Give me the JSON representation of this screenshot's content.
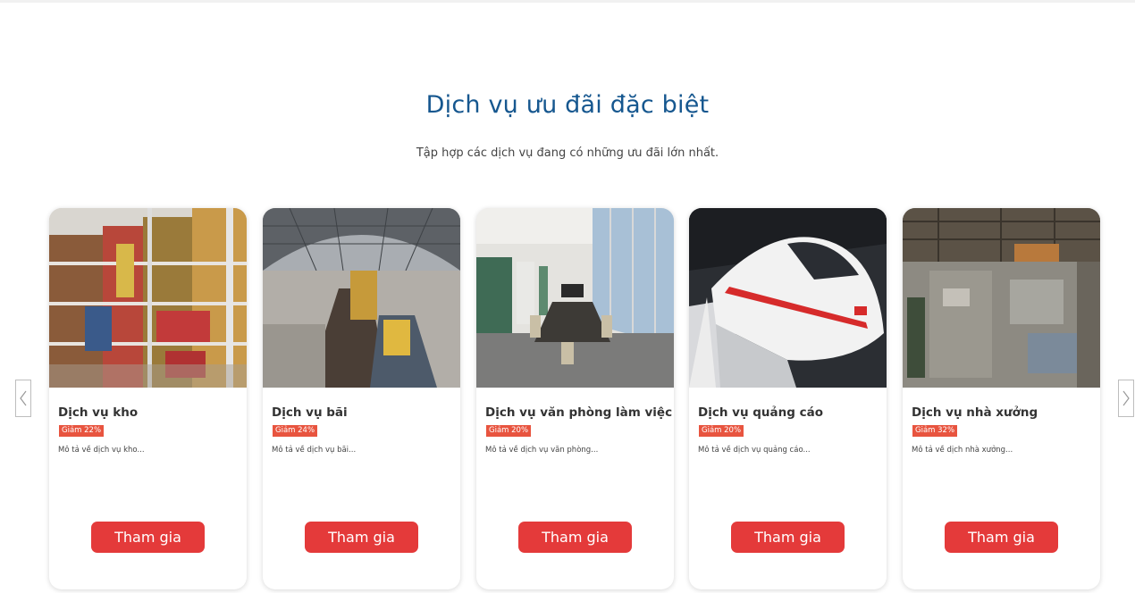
{
  "section": {
    "title": "Dịch vụ ưu đãi đặc biệt",
    "subtitle": "Tập hợp các dịch vụ đang có những ưu đãi lớn nhất."
  },
  "cards": [
    {
      "title": "Dịch vụ kho",
      "discount": "Giảm 22%",
      "description": "Mô tả về dịch vụ kho...",
      "button": "Tham gia",
      "image": "warehouse-shelves-photo"
    },
    {
      "title": "Dịch vụ bãi",
      "discount": "Giảm 24%",
      "description": "Mô tả về dịch vụ bãi...",
      "button": "Tham gia",
      "image": "train-station-photo"
    },
    {
      "title": "Dịch vụ văn phòng làm việc",
      "discount": "Giảm 20%",
      "description": "Mô tả về dịch vụ văn phòng...",
      "button": "Tham gia",
      "image": "meeting-room-photo"
    },
    {
      "title": "Dịch vụ quảng cáo",
      "discount": "Giảm 20%",
      "description": "Mô tả về dịch vụ quảng cáo...",
      "button": "Tham gia",
      "image": "high-speed-train-photo"
    },
    {
      "title": "Dịch vụ nhà xưởng",
      "discount": "Giảm 32%",
      "description": "Mô tả về dịch nhà xưởng...",
      "button": "Tham gia",
      "image": "factory-aerial-photo"
    }
  ],
  "navigation": {
    "prev_icon": "chevron-left-icon",
    "next_icon": "chevron-right-icon"
  },
  "colors": {
    "title": "#16578f",
    "badge": "#e8543f",
    "button": "#e43a3a"
  }
}
